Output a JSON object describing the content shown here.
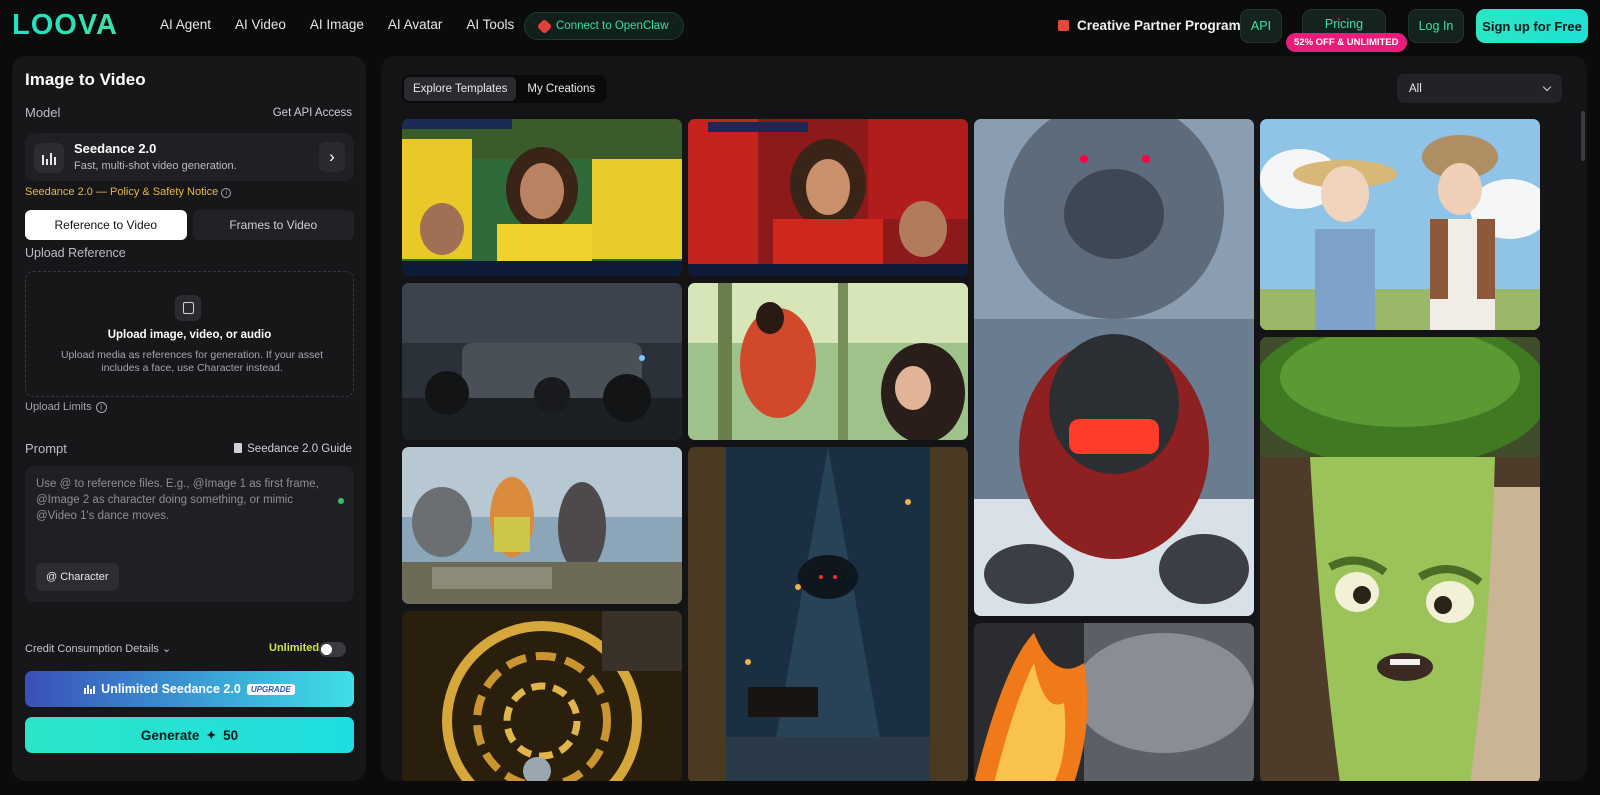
{
  "brand": {
    "logo": "LOOVA"
  },
  "nav": [
    "AI Agent",
    "AI Video",
    "AI Image",
    "AI Avatar",
    "AI Tools"
  ],
  "header": {
    "openclaw": "Connect to OpenClaw",
    "partner": "Creative Partner Program",
    "api": "API",
    "pricing": "Pricing",
    "pricing_badge": "52% OFF & UNLIMITED",
    "login": "Log In",
    "signup": "Sign up for Free"
  },
  "panel": {
    "title": "Image to Video",
    "model_label": "Model",
    "api_access": "Get API Access",
    "model_name": "Seedance 2.0",
    "model_desc": "Fast, multi-shot video generation.",
    "policy": "Seedance 2.0 — Policy & Safety Notice",
    "modes": [
      "Reference to Video",
      "Frames to Video"
    ],
    "upload_label": "Upload Reference",
    "upload_title": "Upload image, video, or audio",
    "upload_desc": "Upload media as references for generation. If your asset includes a face, use Character instead.",
    "upload_limits": "Upload Limits",
    "prompt_label": "Prompt",
    "guide": "Seedance 2.0 Guide",
    "prompt_placeholder": "Use @ to reference files. E.g., @Image 1 as first frame, @Image 2 as character doing something, or mimic @Video 1's dance moves.",
    "character_btn": "@ Character",
    "credit_details": "Credit Consumption Details ⌄",
    "unlimited_label": "Unlimited",
    "unlimited_btn": "Unlimited Seedance 2.0",
    "upgrade": "UPGRADE",
    "generate": "Generate",
    "cost": "50"
  },
  "gallery": {
    "tabs": [
      "Explore Templates",
      "My Creations"
    ],
    "filter": "All"
  },
  "colors": {
    "accent": "#2ae6c8",
    "policy": "#e6b84a",
    "badge": "#e61e7a"
  }
}
